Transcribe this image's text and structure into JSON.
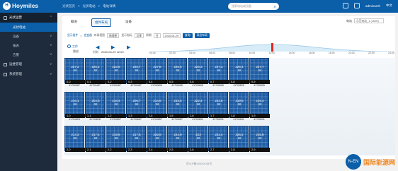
{
  "app": {
    "logo": "Hoymiles"
  },
  "top_nav": [
    "光伏首页",
    "光伏电站",
    "电站详情"
  ],
  "search": {
    "placeholder": "搜索电站或设备"
  },
  "user": {
    "name": "adminamh",
    "lang": "中文"
  },
  "sidebar": {
    "sections": [
      {
        "label": "光伏运营",
        "subs": [
          {
            "label": "光伏电站",
            "selected": true
          },
          {
            "label": "设备"
          },
          {
            "label": "报表"
          },
          {
            "label": "告警"
          }
        ]
      },
      {
        "label": "运维管理"
      },
      {
        "label": "系统管理"
      }
    ]
  },
  "tabs": [
    "概况",
    "组件布局",
    "设备"
  ],
  "site_picker": {
    "label": "电站",
    "value": "示范电站_1 (1MW)"
  },
  "filters": {
    "breadcrumb": [
      "显示组件",
      "逆变器"
    ],
    "view_label": "布局视图",
    "view_value": "物理图",
    "metric_label": "显示指标",
    "metric_value": "功率",
    "period_label": "周期",
    "period_value": "日",
    "date": "2020-04-29",
    "btn_query": "查询",
    "btn_export": "导出布局"
  },
  "playback": {
    "mode": "工作",
    "mode2": "播放",
    "time_label": "时刻",
    "time_value": "2020-04-29 12:00"
  },
  "time_ticks": [
    "00:00",
    "02:00",
    "04:00",
    "06:00",
    "08:00",
    "10:00",
    "12:00",
    "14:00",
    "16:00",
    "18:00",
    "20:00",
    "22:00",
    "24:00"
  ],
  "cursor_fraction": 0.5,
  "colors": {
    "accent": "#0b5ea8",
    "sidebar_bg": "#1e2b3c",
    "panel": "#1f5ea6",
    "cursor": "#e2261f"
  },
  "panels": [
    {
      "name": "0-0",
      "power": "227.2",
      "unit": "W",
      "sn": "41700487"
    },
    {
      "name": "0-1",
      "power": "225.2",
      "unit": "W",
      "sn": "41700487"
    },
    {
      "name": "0-2",
      "power": "223.9",
      "unit": "W",
      "sn": "41700487"
    },
    {
      "name": "0-3",
      "power": "225.7",
      "unit": "W",
      "sn": "41700487"
    },
    {
      "name": "0-4",
      "power": "227.8",
      "unit": "W",
      "sn": "41700695"
    },
    {
      "name": "0-5",
      "power": "226.5",
      "unit": "W",
      "sn": "41700695"
    },
    {
      "name": "0-6",
      "power": "226.3",
      "unit": "W",
      "sn": "41700695"
    },
    {
      "name": "0-7",
      "power": "227.2",
      "unit": "W",
      "sn": "41700695"
    },
    {
      "name": "0-8",
      "power": "226.4",
      "unit": "W",
      "sn": "41700828"
    },
    {
      "name": "0-9",
      "power": "227.7",
      "unit": "W",
      "sn": "41700828"
    },
    {
      "name": "1-0",
      "power": "216.1",
      "unit": "W",
      "sn": "41700828"
    },
    {
      "name": "1-1",
      "power": "204.6",
      "unit": "W",
      "sn": "41700828"
    },
    {
      "name": "1-2",
      "power": "218.4",
      "unit": "W",
      "sn": "41700657"
    },
    {
      "name": "1-3",
      "power": "206.7",
      "unit": "W",
      "sn": "41700657"
    },
    {
      "name": "1-4",
      "power": "214.6",
      "unit": "W",
      "sn": "41700657"
    },
    {
      "name": "1-5",
      "power": "215.5",
      "unit": "W",
      "sn": "41700657"
    },
    {
      "name": "1-6",
      "power": "222.4",
      "unit": "W",
      "sn": "41700631"
    },
    {
      "name": "1-7",
      "power": "222.6",
      "unit": "W",
      "sn": "41700631"
    },
    {
      "name": "1-8",
      "power": "219.5",
      "unit": "W",
      "sn": "41700631"
    },
    {
      "name": "1-9",
      "power": "216.4",
      "unit": "W",
      "sn": "41700631"
    },
    {
      "name": "2-0",
      "power": "214.3",
      "unit": "W",
      "sn": ""
    },
    {
      "name": "2-1",
      "power": "217.4",
      "unit": "W",
      "sn": ""
    },
    {
      "name": "2-2",
      "power": "219.6",
      "unit": "W",
      "sn": ""
    },
    {
      "name": "2-3",
      "power": "217.5",
      "unit": "W",
      "sn": ""
    },
    {
      "name": "2-4",
      "power": "225.9",
      "unit": "W",
      "sn": ""
    },
    {
      "name": "2-5",
      "power": "224.9",
      "unit": "W",
      "sn": ""
    },
    {
      "name": "2-6",
      "power": "223",
      "unit": "W",
      "sn": ""
    },
    {
      "name": "2-7",
      "power": "222.4",
      "unit": "W",
      "sn": ""
    },
    {
      "name": "2-8",
      "power": "226.2",
      "unit": "W",
      "sn": ""
    },
    {
      "name": "2-9",
      "power": "226.8",
      "unit": "W",
      "sn": ""
    }
  ],
  "footer": "京ICP备19029195号",
  "watermark": {
    "mark": "N-EN",
    "text": "国际能源网"
  }
}
